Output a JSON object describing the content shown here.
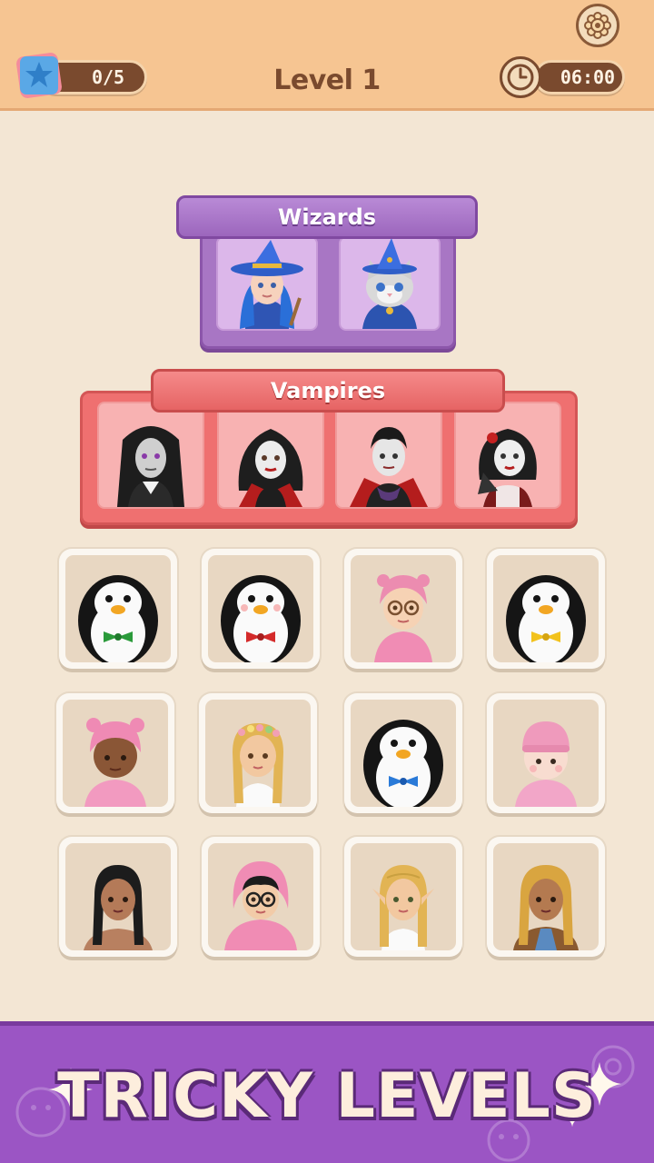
{
  "header": {
    "level_title": "Level 1",
    "stars_progress": "0/5",
    "timer": "06:00",
    "star_icon": "star-icon",
    "clock_icon": "clock-icon",
    "settings_icon": "gear-icon"
  },
  "categories": [
    {
      "name": "Wizards",
      "color": "#a876c4",
      "slots": [
        "wizard-girl-avatar",
        "wizard-cat-avatar"
      ]
    },
    {
      "name": "Vampires",
      "color": "#ef7070",
      "slots": [
        "vampire-long-hair-avatar",
        "vampire-woman-avatar",
        "vampire-man-avatar",
        "vampire-lady-fan-avatar"
      ]
    }
  ],
  "tiles": [
    [
      "penguin-green-bowtie",
      "penguin-red-bowtie",
      "girl-pink-bear-hat-glasses",
      "penguin-yellow-bowtie"
    ],
    [
      "baby-pink-bear-hat",
      "girl-flower-crown-braids",
      "penguin-blue-bowtie",
      "baby-pink-beanie"
    ],
    [
      "girl-black-braids",
      "kid-pink-hoodie-glasses",
      "elf-blonde-braids",
      "girl-golden-braids"
    ]
  ],
  "promo": {
    "text": "TRICKY LEVELS",
    "color": "#9b55c4"
  }
}
